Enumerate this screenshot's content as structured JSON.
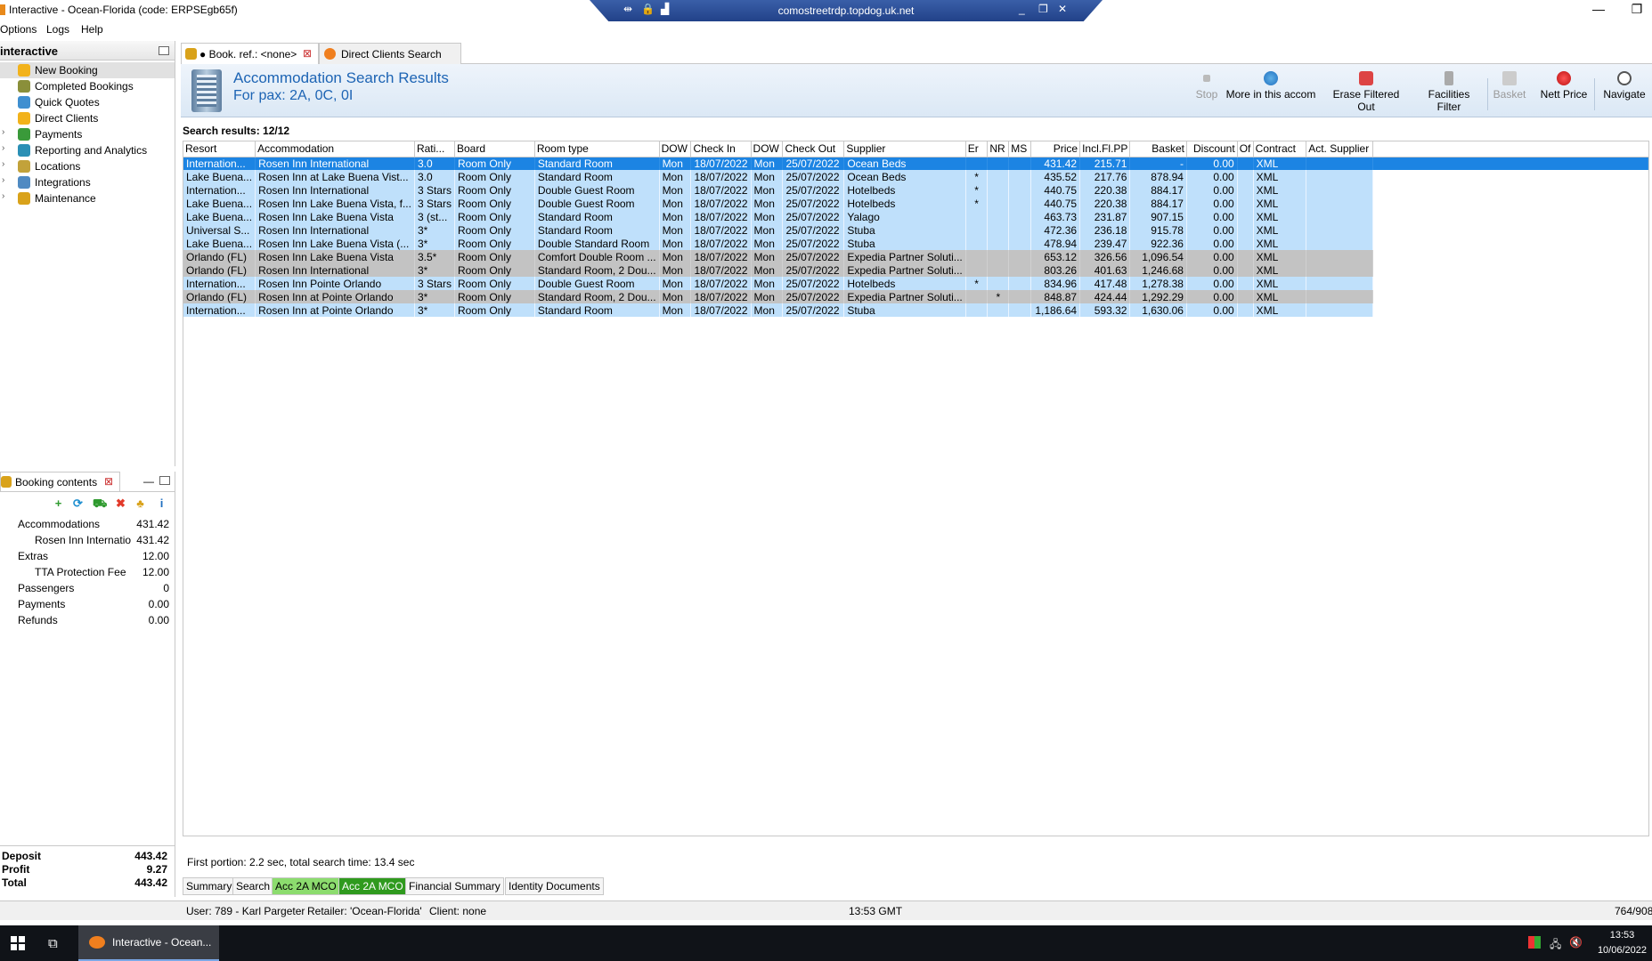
{
  "window": {
    "title": "Interactive - Ocean-Florida (code: ERPSEgb65f)",
    "rdp_host": "comostreetrdp.topdog.uk.net",
    "minimize": "—",
    "restore": "❐"
  },
  "menu": [
    "Options",
    "Logs",
    "Help"
  ],
  "left_panel": {
    "title": "interactive",
    "items": [
      {
        "label": "New Booking",
        "icon": "palm-icon",
        "color": "#f2b21b"
      },
      {
        "label": "Completed Bookings",
        "icon": "palm-icon",
        "color": "#8a8f3a"
      },
      {
        "label": "Quick Quotes",
        "icon": "globe-icon",
        "color": "#3f8fd0"
      },
      {
        "label": "Direct Clients",
        "icon": "palm-icon",
        "color": "#f2b21b"
      },
      {
        "label": "Payments",
        "icon": "money-icon",
        "color": "#3a9a3a"
      },
      {
        "label": "Reporting and Analytics",
        "icon": "chart-icon",
        "color": "#2a8fb5"
      },
      {
        "label": "Locations",
        "icon": "map-icon",
        "color": "#c2a23a"
      },
      {
        "label": "Integrations",
        "icon": "gears-icon",
        "color": "#4f8ac2"
      },
      {
        "label": "Maintenance",
        "icon": "globe-icon",
        "color": "#d9a21a"
      }
    ]
  },
  "booking_contents": {
    "tab_label": "Booking contents",
    "rows": [
      {
        "label": "Accommodations",
        "value": "431.42",
        "indent": 0
      },
      {
        "label": "Rosen Inn Internatio",
        "value": "431.42",
        "indent": 1
      },
      {
        "label": "Extras",
        "value": "12.00",
        "indent": 0
      },
      {
        "label": "TTA Protection Fee",
        "value": "12.00",
        "indent": 1
      },
      {
        "label": "Passengers",
        "value": "0",
        "indent": 0
      },
      {
        "label": "Payments",
        "value": "0.00",
        "indent": 0
      },
      {
        "label": "Refunds",
        "value": "0.00",
        "indent": 0
      }
    ],
    "totals": [
      {
        "label": "Deposit",
        "value": "443.42"
      },
      {
        "label": "Profit",
        "value": "9.27"
      },
      {
        "label": "Total",
        "value": "443.42"
      }
    ]
  },
  "tabs": [
    {
      "label": "● Book. ref.: <none>",
      "active": true
    },
    {
      "label": "Direct Clients Search",
      "active": false
    }
  ],
  "header": {
    "title": "Accommodation Search Results",
    "subtitle": "For pax: 2A, 0C, 0I",
    "buttons": [
      {
        "label": "Stop",
        "enabled": false
      },
      {
        "label": "More in this accom",
        "enabled": true
      },
      {
        "label": "Erase Filtered Out",
        "enabled": true
      },
      {
        "label": "Facilities Filter",
        "enabled": true
      },
      {
        "label": "Basket",
        "enabled": false
      },
      {
        "label": "Nett Price",
        "enabled": true
      },
      {
        "label": "Navigate",
        "enabled": true
      }
    ]
  },
  "results": {
    "summary": "Search results: 12/12",
    "columns": [
      "Resort",
      "Accommodation",
      "Rati...",
      "Board",
      "Room type",
      "DOW",
      "Check In",
      "DOW",
      "Check Out",
      "Supplier",
      "Er",
      "NR",
      "MS",
      "Price",
      "Incl.Fl.PP",
      "Basket",
      "Discount",
      "Of",
      "Contract",
      "Act. Supplier"
    ],
    "rows": [
      {
        "style": "sel",
        "cells": [
          "Internation...",
          "Rosen Inn International",
          "3.0",
          "Room Only",
          "Standard Room",
          "Mon",
          "18/07/2022",
          "Mon",
          "25/07/2022",
          "Ocean Beds",
          "",
          "",
          "",
          "431.42",
          "215.71",
          "-",
          "0.00",
          "",
          "XML",
          ""
        ]
      },
      {
        "style": "A",
        "cells": [
          "Lake Buena...",
          "Rosen Inn at Lake Buena Vist...",
          "3.0",
          "Room Only",
          "Standard Room",
          "Mon",
          "18/07/2022",
          "Mon",
          "25/07/2022",
          "Ocean Beds",
          "*",
          "",
          "",
          "435.52",
          "217.76",
          "878.94",
          "0.00",
          "",
          "XML",
          ""
        ]
      },
      {
        "style": "A",
        "cells": [
          "Internation...",
          "Rosen Inn International",
          "3 Stars",
          "Room Only",
          "Double Guest Room",
          "Mon",
          "18/07/2022",
          "Mon",
          "25/07/2022",
          "Hotelbeds",
          "*",
          "",
          "",
          "440.75",
          "220.38",
          "884.17",
          "0.00",
          "",
          "XML",
          ""
        ]
      },
      {
        "style": "A",
        "cells": [
          "Lake Buena...",
          "Rosen Inn Lake Buena Vista, f...",
          "3 Stars",
          "Room Only",
          "Double Guest Room",
          "Mon",
          "18/07/2022",
          "Mon",
          "25/07/2022",
          "Hotelbeds",
          "*",
          "",
          "",
          "440.75",
          "220.38",
          "884.17",
          "0.00",
          "",
          "XML",
          ""
        ]
      },
      {
        "style": "A",
        "cells": [
          "Lake Buena...",
          "Rosen Inn Lake Buena Vista",
          "3 (st...",
          "Room Only",
          "Standard Room",
          "Mon",
          "18/07/2022",
          "Mon",
          "25/07/2022",
          "Yalago",
          "",
          "",
          "",
          "463.73",
          "231.87",
          "907.15",
          "0.00",
          "",
          "XML",
          ""
        ]
      },
      {
        "style": "A",
        "cells": [
          "Universal S...",
          "Rosen Inn International",
          "3*",
          "Room Only",
          "Standard Room",
          "Mon",
          "18/07/2022",
          "Mon",
          "25/07/2022",
          "Stuba",
          "",
          "",
          "",
          "472.36",
          "236.18",
          "915.78",
          "0.00",
          "",
          "XML",
          ""
        ]
      },
      {
        "style": "A",
        "cells": [
          "Lake Buena...",
          "Rosen Inn Lake Buena Vista (...",
          "3*",
          "Room Only",
          "Double Standard Room",
          "Mon",
          "18/07/2022",
          "Mon",
          "25/07/2022",
          "Stuba",
          "",
          "",
          "",
          "478.94",
          "239.47",
          "922.36",
          "0.00",
          "",
          "XML",
          ""
        ]
      },
      {
        "style": "B",
        "cells": [
          "Orlando (FL)",
          "Rosen Inn Lake Buena Vista",
          "3.5*",
          "Room Only",
          "Comfort Double Room ...",
          "Mon",
          "18/07/2022",
          "Mon",
          "25/07/2022",
          "Expedia Partner Soluti...",
          "",
          "",
          "",
          "653.12",
          "326.56",
          "1,096.54",
          "0.00",
          "",
          "XML",
          ""
        ]
      },
      {
        "style": "B",
        "cells": [
          "Orlando (FL)",
          "Rosen Inn International",
          "3*",
          "Room Only",
          "Standard Room, 2 Dou...",
          "Mon",
          "18/07/2022",
          "Mon",
          "25/07/2022",
          "Expedia Partner Soluti...",
          "",
          "",
          "",
          "803.26",
          "401.63",
          "1,246.68",
          "0.00",
          "",
          "XML",
          ""
        ]
      },
      {
        "style": "A",
        "cells": [
          "Internation...",
          "Rosen Inn Pointe Orlando",
          "3 Stars",
          "Room Only",
          "Double Guest Room",
          "Mon",
          "18/07/2022",
          "Mon",
          "25/07/2022",
          "Hotelbeds",
          "*",
          "",
          "",
          "834.96",
          "417.48",
          "1,278.38",
          "0.00",
          "",
          "XML",
          ""
        ]
      },
      {
        "style": "B",
        "cells": [
          "Orlando (FL)",
          "Rosen Inn at Pointe Orlando",
          "3*",
          "Room Only",
          "Standard Room, 2 Dou...",
          "Mon",
          "18/07/2022",
          "Mon",
          "25/07/2022",
          "Expedia Partner Soluti...",
          "",
          "*",
          "",
          "848.87",
          "424.44",
          "1,292.29",
          "0.00",
          "",
          "XML",
          ""
        ]
      },
      {
        "style": "A",
        "cells": [
          "Internation...",
          "Rosen Inn at Pointe Orlando",
          "3*",
          "Room Only",
          "Standard Room",
          "Mon",
          "18/07/2022",
          "Mon",
          "25/07/2022",
          "Stuba",
          "",
          "",
          "",
          "1,186.64",
          "593.32",
          "1,630.06",
          "0.00",
          "",
          "XML",
          ""
        ]
      }
    ],
    "timing": "First portion: 2.2 sec, total search time: 13.4 sec"
  },
  "bottom_tabs": [
    {
      "label": "Summary",
      "style": ""
    },
    {
      "label": "Search",
      "style": ""
    },
    {
      "label": "Acc 2A MCO",
      "style": "hl"
    },
    {
      "label": "Acc 2A MCO",
      "style": "dk"
    },
    {
      "label": "Financial Summary",
      "style": ""
    },
    {
      "label": "Identity Documents",
      "style": ""
    }
  ],
  "statusbar": {
    "user": "User: 789 - Karl Pargeter",
    "retailer": "Retailer: 'Ocean-Florida'",
    "client": "Client: none",
    "time": "13:53 GMT",
    "memory": "764/908"
  },
  "taskbar": {
    "app_label": "Interactive - Ocean...",
    "time": "13:53",
    "date": "10/06/2022"
  }
}
